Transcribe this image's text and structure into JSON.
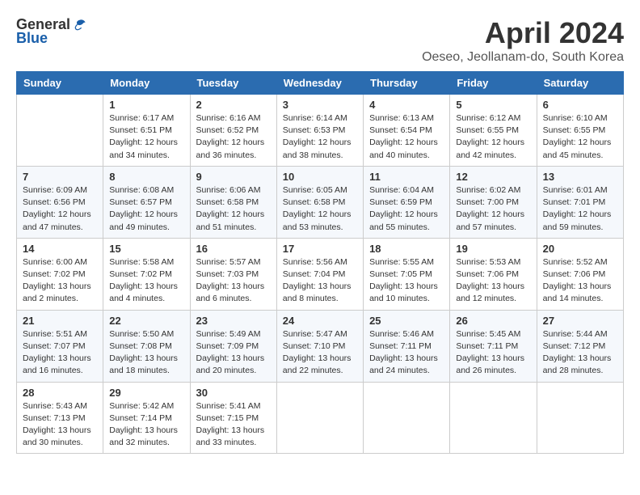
{
  "header": {
    "logo_general": "General",
    "logo_blue": "Blue",
    "month_title": "April 2024",
    "location": "Oeseo, Jeollanam-do, South Korea"
  },
  "calendar": {
    "days_of_week": [
      "Sunday",
      "Monday",
      "Tuesday",
      "Wednesday",
      "Thursday",
      "Friday",
      "Saturday"
    ],
    "weeks": [
      [
        {
          "day": "",
          "info": ""
        },
        {
          "day": "1",
          "info": "Sunrise: 6:17 AM\nSunset: 6:51 PM\nDaylight: 12 hours\nand 34 minutes."
        },
        {
          "day": "2",
          "info": "Sunrise: 6:16 AM\nSunset: 6:52 PM\nDaylight: 12 hours\nand 36 minutes."
        },
        {
          "day": "3",
          "info": "Sunrise: 6:14 AM\nSunset: 6:53 PM\nDaylight: 12 hours\nand 38 minutes."
        },
        {
          "day": "4",
          "info": "Sunrise: 6:13 AM\nSunset: 6:54 PM\nDaylight: 12 hours\nand 40 minutes."
        },
        {
          "day": "5",
          "info": "Sunrise: 6:12 AM\nSunset: 6:55 PM\nDaylight: 12 hours\nand 42 minutes."
        },
        {
          "day": "6",
          "info": "Sunrise: 6:10 AM\nSunset: 6:55 PM\nDaylight: 12 hours\nand 45 minutes."
        }
      ],
      [
        {
          "day": "7",
          "info": "Sunrise: 6:09 AM\nSunset: 6:56 PM\nDaylight: 12 hours\nand 47 minutes."
        },
        {
          "day": "8",
          "info": "Sunrise: 6:08 AM\nSunset: 6:57 PM\nDaylight: 12 hours\nand 49 minutes."
        },
        {
          "day": "9",
          "info": "Sunrise: 6:06 AM\nSunset: 6:58 PM\nDaylight: 12 hours\nand 51 minutes."
        },
        {
          "day": "10",
          "info": "Sunrise: 6:05 AM\nSunset: 6:58 PM\nDaylight: 12 hours\nand 53 minutes."
        },
        {
          "day": "11",
          "info": "Sunrise: 6:04 AM\nSunset: 6:59 PM\nDaylight: 12 hours\nand 55 minutes."
        },
        {
          "day": "12",
          "info": "Sunrise: 6:02 AM\nSunset: 7:00 PM\nDaylight: 12 hours\nand 57 minutes."
        },
        {
          "day": "13",
          "info": "Sunrise: 6:01 AM\nSunset: 7:01 PM\nDaylight: 12 hours\nand 59 minutes."
        }
      ],
      [
        {
          "day": "14",
          "info": "Sunrise: 6:00 AM\nSunset: 7:02 PM\nDaylight: 13 hours\nand 2 minutes."
        },
        {
          "day": "15",
          "info": "Sunrise: 5:58 AM\nSunset: 7:02 PM\nDaylight: 13 hours\nand 4 minutes."
        },
        {
          "day": "16",
          "info": "Sunrise: 5:57 AM\nSunset: 7:03 PM\nDaylight: 13 hours\nand 6 minutes."
        },
        {
          "day": "17",
          "info": "Sunrise: 5:56 AM\nSunset: 7:04 PM\nDaylight: 13 hours\nand 8 minutes."
        },
        {
          "day": "18",
          "info": "Sunrise: 5:55 AM\nSunset: 7:05 PM\nDaylight: 13 hours\nand 10 minutes."
        },
        {
          "day": "19",
          "info": "Sunrise: 5:53 AM\nSunset: 7:06 PM\nDaylight: 13 hours\nand 12 minutes."
        },
        {
          "day": "20",
          "info": "Sunrise: 5:52 AM\nSunset: 7:06 PM\nDaylight: 13 hours\nand 14 minutes."
        }
      ],
      [
        {
          "day": "21",
          "info": "Sunrise: 5:51 AM\nSunset: 7:07 PM\nDaylight: 13 hours\nand 16 minutes."
        },
        {
          "day": "22",
          "info": "Sunrise: 5:50 AM\nSunset: 7:08 PM\nDaylight: 13 hours\nand 18 minutes."
        },
        {
          "day": "23",
          "info": "Sunrise: 5:49 AM\nSunset: 7:09 PM\nDaylight: 13 hours\nand 20 minutes."
        },
        {
          "day": "24",
          "info": "Sunrise: 5:47 AM\nSunset: 7:10 PM\nDaylight: 13 hours\nand 22 minutes."
        },
        {
          "day": "25",
          "info": "Sunrise: 5:46 AM\nSunset: 7:11 PM\nDaylight: 13 hours\nand 24 minutes."
        },
        {
          "day": "26",
          "info": "Sunrise: 5:45 AM\nSunset: 7:11 PM\nDaylight: 13 hours\nand 26 minutes."
        },
        {
          "day": "27",
          "info": "Sunrise: 5:44 AM\nSunset: 7:12 PM\nDaylight: 13 hours\nand 28 minutes."
        }
      ],
      [
        {
          "day": "28",
          "info": "Sunrise: 5:43 AM\nSunset: 7:13 PM\nDaylight: 13 hours\nand 30 minutes."
        },
        {
          "day": "29",
          "info": "Sunrise: 5:42 AM\nSunset: 7:14 PM\nDaylight: 13 hours\nand 32 minutes."
        },
        {
          "day": "30",
          "info": "Sunrise: 5:41 AM\nSunset: 7:15 PM\nDaylight: 13 hours\nand 33 minutes."
        },
        {
          "day": "",
          "info": ""
        },
        {
          "day": "",
          "info": ""
        },
        {
          "day": "",
          "info": ""
        },
        {
          "day": "",
          "info": ""
        }
      ]
    ]
  }
}
